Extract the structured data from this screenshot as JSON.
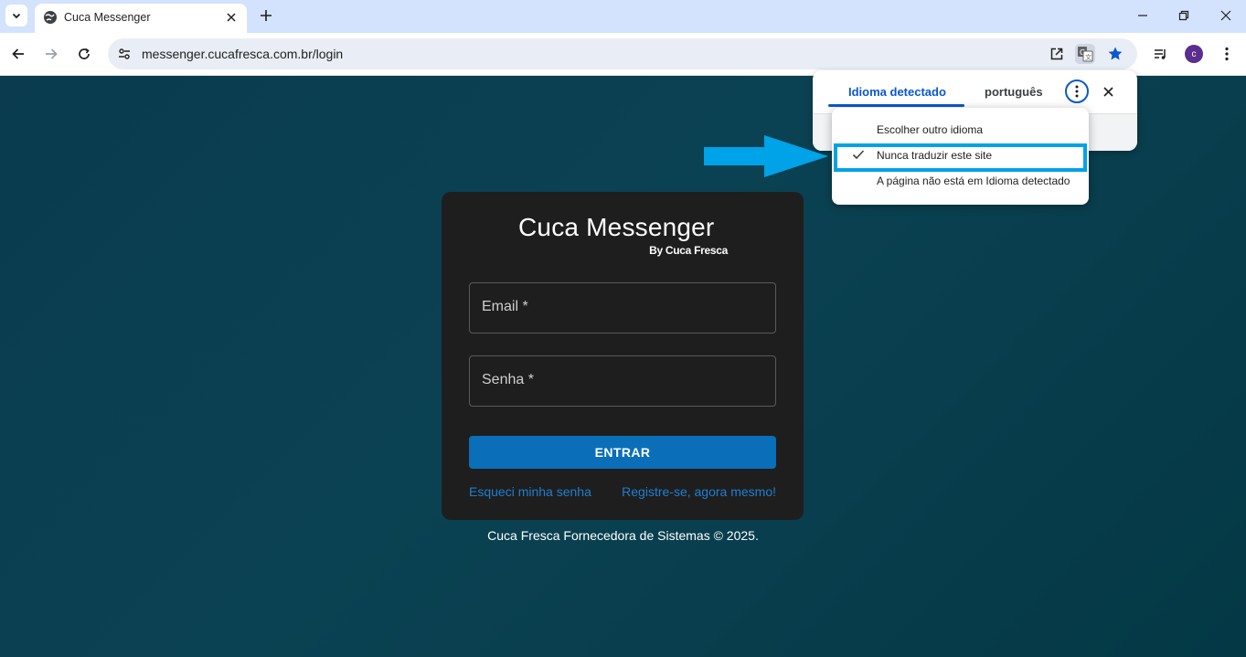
{
  "browser": {
    "tab_title": "Cuca Messenger",
    "url": "messenger.cucafresca.com.br/login",
    "profile_initial": "c"
  },
  "icons": {
    "tab_search": "chevron-down-icon",
    "favicon": "globe-icon",
    "tab_close": "close-icon",
    "new_tab": "plus-icon",
    "minimize": "minimize-icon",
    "restore": "restore-icon",
    "close_window": "close-icon",
    "back": "arrow-left-icon",
    "forward": "arrow-right-icon",
    "reload": "reload-icon",
    "site_info": "tune-icon",
    "open_in_app": "open-external-icon",
    "translate": "translate-icon",
    "bookmark": "star-icon",
    "media": "media-queue-icon",
    "menu": "kebab-menu-icon"
  },
  "colors": {
    "accent": "#0b57d0",
    "button": "#0a6fb8",
    "link": "#1e7fd2",
    "highlight": "#00a2e8"
  },
  "login": {
    "brand_title": "Cuca Messenger",
    "brand_subtitle": "By Cuca Fresca",
    "email_label": "Email *",
    "password_label": "Senha *",
    "submit_label": "ENTRAR",
    "forgot_link": "Esqueci minha senha",
    "register_link": "Registre-se, agora mesmo!"
  },
  "footer": {
    "text": "Cuca Fresca Fornecedora de Sistemas © 2025."
  },
  "translate": {
    "tab_detected": "Idioma detectado",
    "tab_target": "português",
    "menu": [
      {
        "label": "Escolher outro idioma",
        "checked": false
      },
      {
        "label": "Nunca traduzir este site",
        "checked": true
      },
      {
        "label": "A página não está em Idioma detectado",
        "checked": false
      }
    ]
  }
}
